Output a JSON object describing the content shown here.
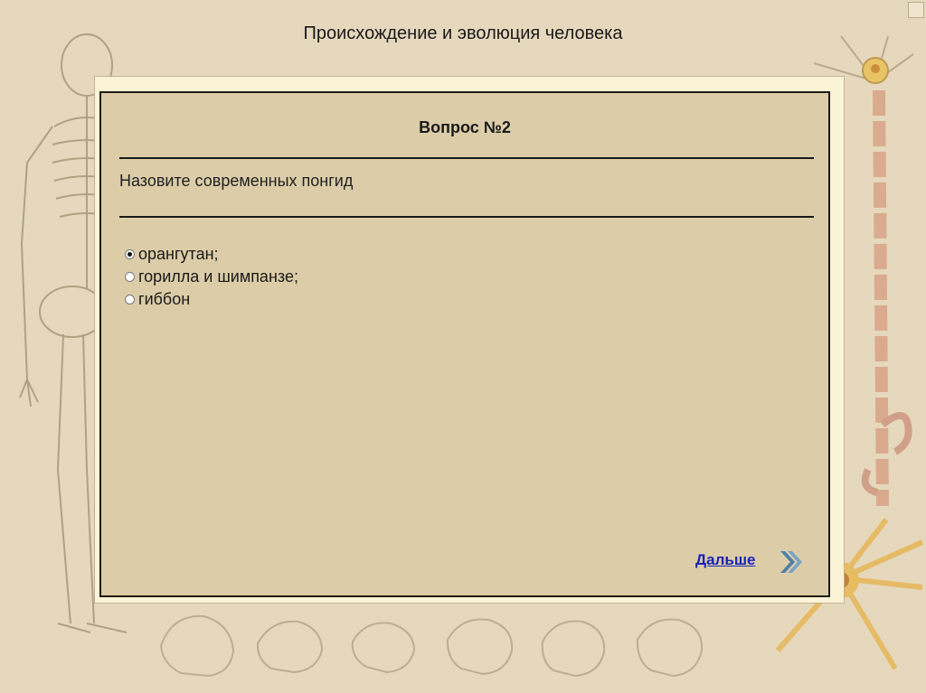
{
  "app": {
    "title": "Происхождение и эволюция человека"
  },
  "question": {
    "header": "Вопрос №2",
    "text": "Назовите современных понгид",
    "options": [
      {
        "label": "орангутан;",
        "selected": true
      },
      {
        "label": "горилла и шимпанзе;",
        "selected": false
      },
      {
        "label": "гиббон",
        "selected": false
      }
    ]
  },
  "navigation": {
    "next_label": "Дальше"
  },
  "icons": {
    "next": "double-chevron-right-icon",
    "background": [
      "skeleton-illustration",
      "neuron-illustration",
      "skulls-row"
    ]
  },
  "colors": {
    "background": "#e6d8bd",
    "panel": "#dccda8",
    "frame": "#fbf3d6",
    "link": "#1a24b4",
    "arrow": "#4f7fa8"
  }
}
